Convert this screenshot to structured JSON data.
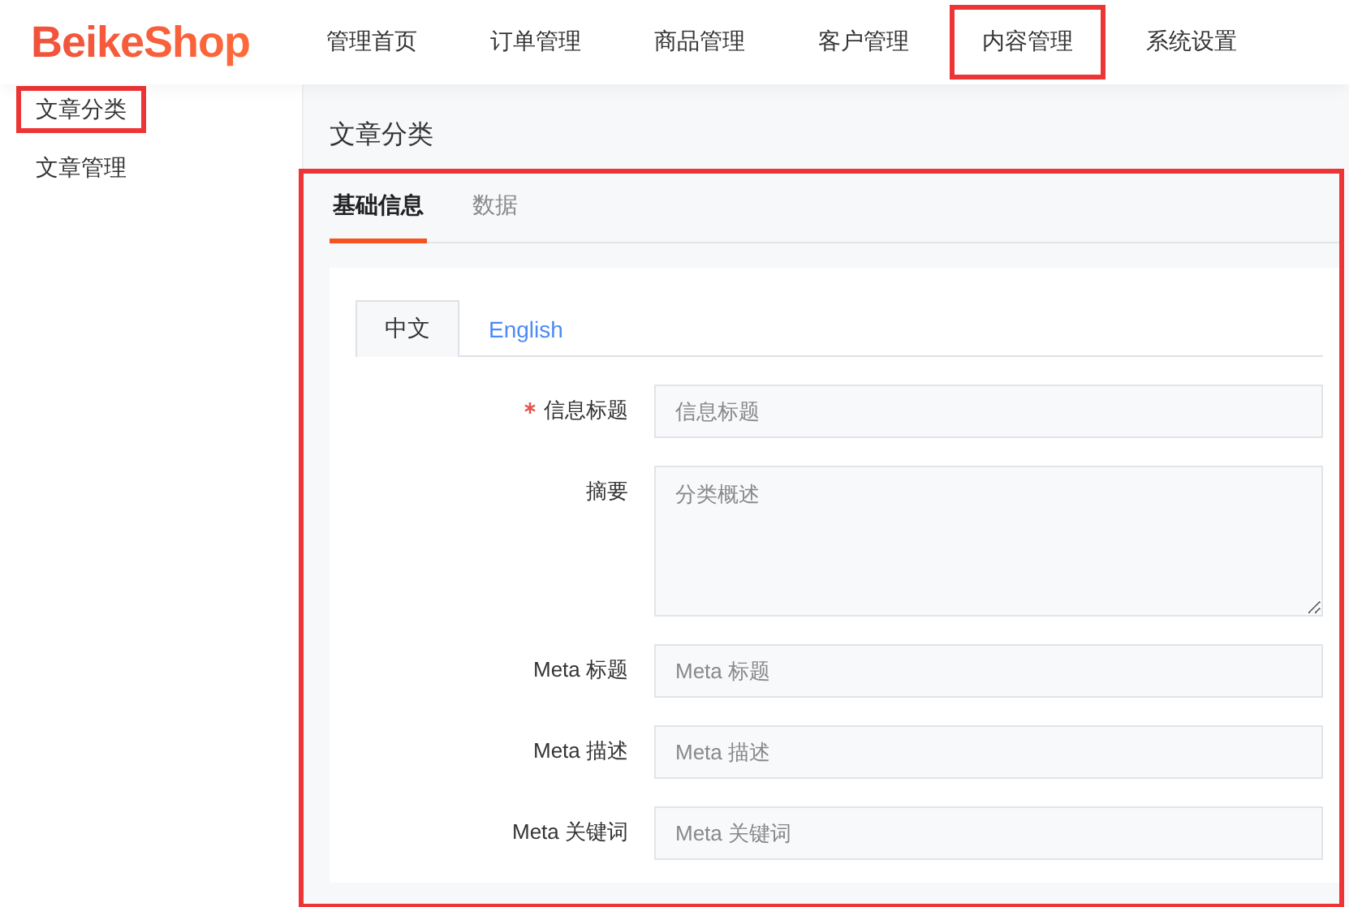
{
  "logo": "BeikeShop",
  "nav": [
    {
      "label": "管理首页",
      "highlighted": false
    },
    {
      "label": "订单管理",
      "highlighted": false
    },
    {
      "label": "商品管理",
      "highlighted": false
    },
    {
      "label": "客户管理",
      "highlighted": false
    },
    {
      "label": "内容管理",
      "highlighted": true
    },
    {
      "label": "系统设置",
      "highlighted": false
    }
  ],
  "sidebar": {
    "items": [
      {
        "label": "文章分类",
        "highlighted": true
      },
      {
        "label": "文章管理",
        "highlighted": false
      }
    ]
  },
  "page_title": "文章分类",
  "panel": {
    "highlighted": true,
    "tabs": [
      {
        "label": "基础信息",
        "selected": true
      },
      {
        "label": "数据",
        "selected": false
      }
    ],
    "language_tabs": [
      {
        "label": "中文",
        "selected": true
      },
      {
        "label": "English",
        "selected": false
      }
    ],
    "fields": [
      {
        "kind": "input",
        "label": "信息标题",
        "required": true,
        "placeholder": "信息标题"
      },
      {
        "kind": "textarea",
        "label": "摘要",
        "required": false,
        "placeholder": "分类概述"
      },
      {
        "kind": "input",
        "label": "Meta 标题",
        "required": false,
        "placeholder": "Meta 标题"
      },
      {
        "kind": "input",
        "label": "Meta 描述",
        "required": false,
        "placeholder": "Meta 描述"
      },
      {
        "kind": "input",
        "label": "Meta 关键词",
        "required": false,
        "placeholder": "Meta 关键词"
      }
    ]
  }
}
